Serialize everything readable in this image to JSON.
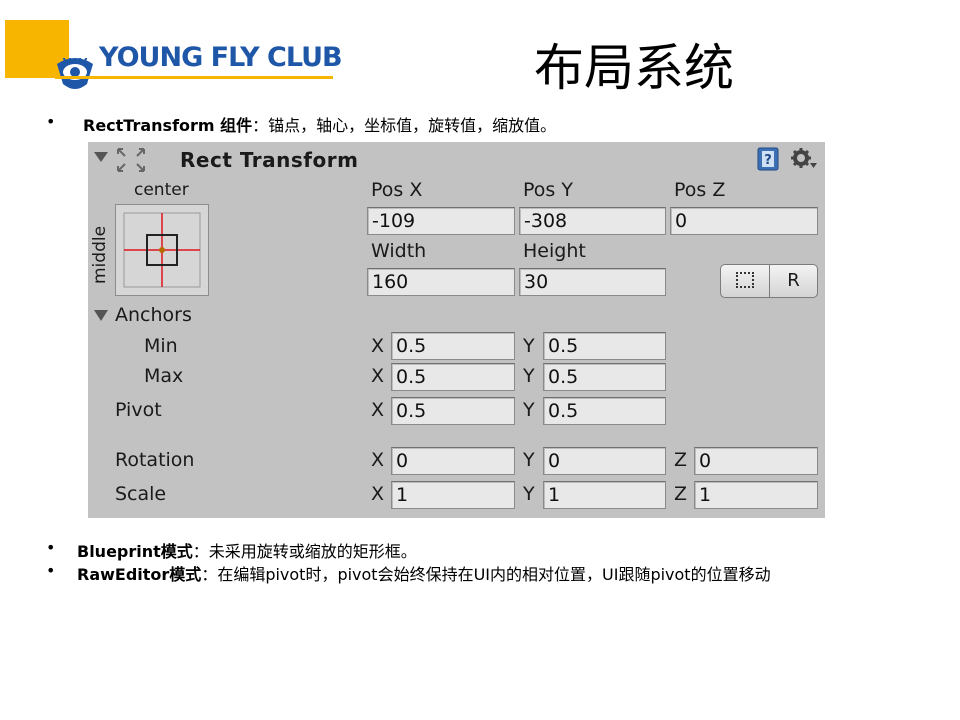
{
  "logo": {
    "text": "YOUNG FLY CLUB"
  },
  "page_title": "布局系统",
  "bullets": [
    {
      "marker": "•",
      "bold": "RectTransform 组件",
      "rest": "：锚点，轴心，坐标值，旋转值，缩放值。"
    },
    {
      "marker": "•",
      "bold": "Blueprint模式",
      "rest": "：未采用旋转或缩放的矩形框。"
    },
    {
      "marker": "•",
      "bold": "RawEditor模式",
      "rest": "：在编辑pivot时，pivot会始终保持在UI内的相对位置，UI跟随pivot的位置移动"
    }
  ],
  "inspector": {
    "title": "Rect Transform",
    "icons": {
      "collapse": "triangle-down-icon",
      "component": "rect-transform-icon",
      "help": "help-book-icon",
      "settings": "gear-icon"
    },
    "anchor_preset": {
      "horizontal": "center",
      "vertical": "middle"
    },
    "pos_labels": [
      "Pos X",
      "Pos Y",
      "Pos Z"
    ],
    "pos_values": [
      "-109",
      "-308",
      "0"
    ],
    "size_labels": [
      "Width",
      "Height"
    ],
    "size_values": [
      "160",
      "30"
    ],
    "buttons": {
      "blueprint": "blueprint-mode-icon",
      "raw": "R"
    },
    "anchors_label": "Anchors",
    "min": {
      "label": "Min",
      "x_label": "X",
      "x": "0.5",
      "y_label": "Y",
      "y": "0.5"
    },
    "max": {
      "label": "Max",
      "x_label": "X",
      "x": "0.5",
      "y_label": "Y",
      "y": "0.5"
    },
    "pivot": {
      "label": "Pivot",
      "x_label": "X",
      "x": "0.5",
      "y_label": "Y",
      "y": "0.5"
    },
    "rotation": {
      "label": "Rotation",
      "x_label": "X",
      "x": "0",
      "y_label": "Y",
      "y": "0",
      "z_label": "Z",
      "z": "0"
    },
    "scale": {
      "label": "Scale",
      "x_label": "X",
      "x": "1",
      "y_label": "Y",
      "y": "1",
      "z_label": "Z",
      "z": "1"
    }
  },
  "colors": {
    "panel_bg": "#c2c2c2",
    "field_bg": "#e8e8e8",
    "logo_blue": "#1f57a8",
    "logo_yellow": "#f7b500",
    "anchor_red": "#e0141e"
  }
}
